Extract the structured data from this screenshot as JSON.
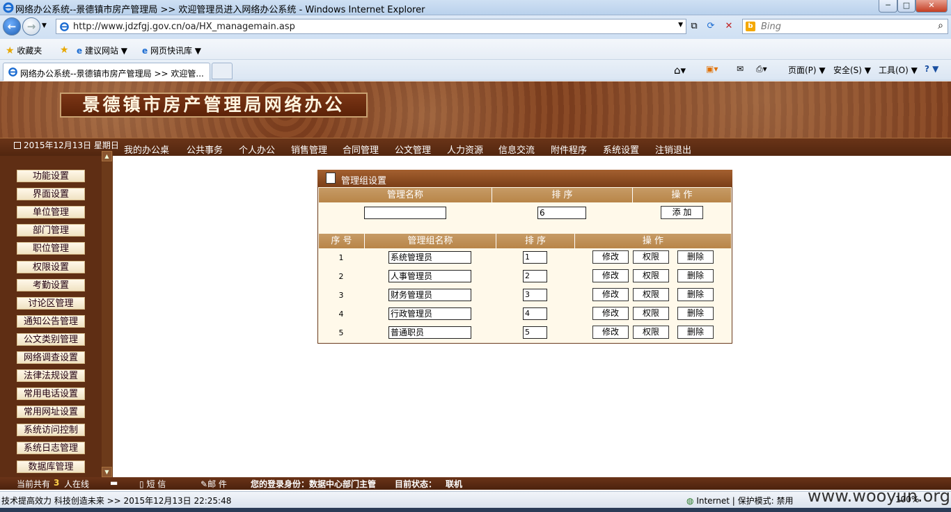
{
  "window": {
    "title": "网络办公系统--景德镇市房产管理局 >> 欢迎管理员进入网络办公系统 - Windows Internet Explorer",
    "min_label": "─",
    "max_label": "□",
    "close_label": "✕"
  },
  "address": {
    "url": "http://www.jdzfgj.gov.cn/oa/HX_managemain.asp",
    "search_placeholder": "Bing"
  },
  "favorites": {
    "fav_label": "收藏夹",
    "suggested_label": "建议网站 ▼",
    "webslice_label": "网页快讯库 ▼"
  },
  "tabs": [
    {
      "label": "网络办公系统--景德镇市房产管理局 >> 欢迎管..."
    }
  ],
  "commandbar": {
    "page_label": "页面(P) ▼",
    "safety_label": "安全(S) ▼",
    "tools_label": "工具(O) ▼",
    "help_label": "? ▼"
  },
  "banner": {
    "title": "景德镇市房产管理局网络办公"
  },
  "nav": {
    "date": "2015年12月13日 星期日",
    "items": [
      "我的办公桌",
      "公共事务",
      "个人办公",
      "销售管理",
      "合同管理",
      "公文管理",
      "人力资源",
      "信息交流",
      "附件程序",
      "系统设置",
      "注销退出"
    ]
  },
  "sidebar": {
    "items": [
      "功能设置",
      "界面设置",
      "单位管理",
      "部门管理",
      "职位管理",
      "权限设置",
      "考勤设置",
      "讨论区管理",
      "通知公告管理",
      "公文类别管理",
      "网络调查设置",
      "法律法规设置",
      "常用电话设置",
      "常用网址设置",
      "系统访问控制",
      "系统日志管理",
      "数据库管理"
    ]
  },
  "panel": {
    "title": "管理组设置",
    "add_headers": [
      "管理名称",
      "排 序",
      "操 作"
    ],
    "add_order_value": "6",
    "add_button": "添 加",
    "list_headers": [
      "序 号",
      "管理组名称",
      "排 序",
      "操 作"
    ],
    "rows": [
      {
        "no": "1",
        "name": "系统管理员",
        "order": "1"
      },
      {
        "no": "2",
        "name": "人事管理员",
        "order": "2"
      },
      {
        "no": "3",
        "name": "财务管理员",
        "order": "3"
      },
      {
        "no": "4",
        "name": "行政管理员",
        "order": "4"
      },
      {
        "no": "5",
        "name": "普通职员",
        "order": "5"
      }
    ],
    "edit_label": "修改",
    "perm_label": "权限",
    "delete_label": "删除"
  },
  "footer": {
    "online_prefix": "当前共有",
    "online_count": "3",
    "online_suffix": "人在线",
    "sms_label": "短 信",
    "mail_label": "邮 件",
    "identity": "您的登录身份：数据中心部门主管",
    "state_label": "目前状态：",
    "state_value": "联机"
  },
  "iestatus": {
    "left_text": "技术提高效力  科技创造未来 >> 2015年12月13日 22:25:48",
    "zone": "Internet | 保护模式: 禁用",
    "zoom": "100%",
    "watermark": "www.wooyun.org"
  },
  "colors": {
    "accent": "#7a3d1e",
    "header_bar": "#b88548",
    "panel_bg": "#fff9ea"
  }
}
